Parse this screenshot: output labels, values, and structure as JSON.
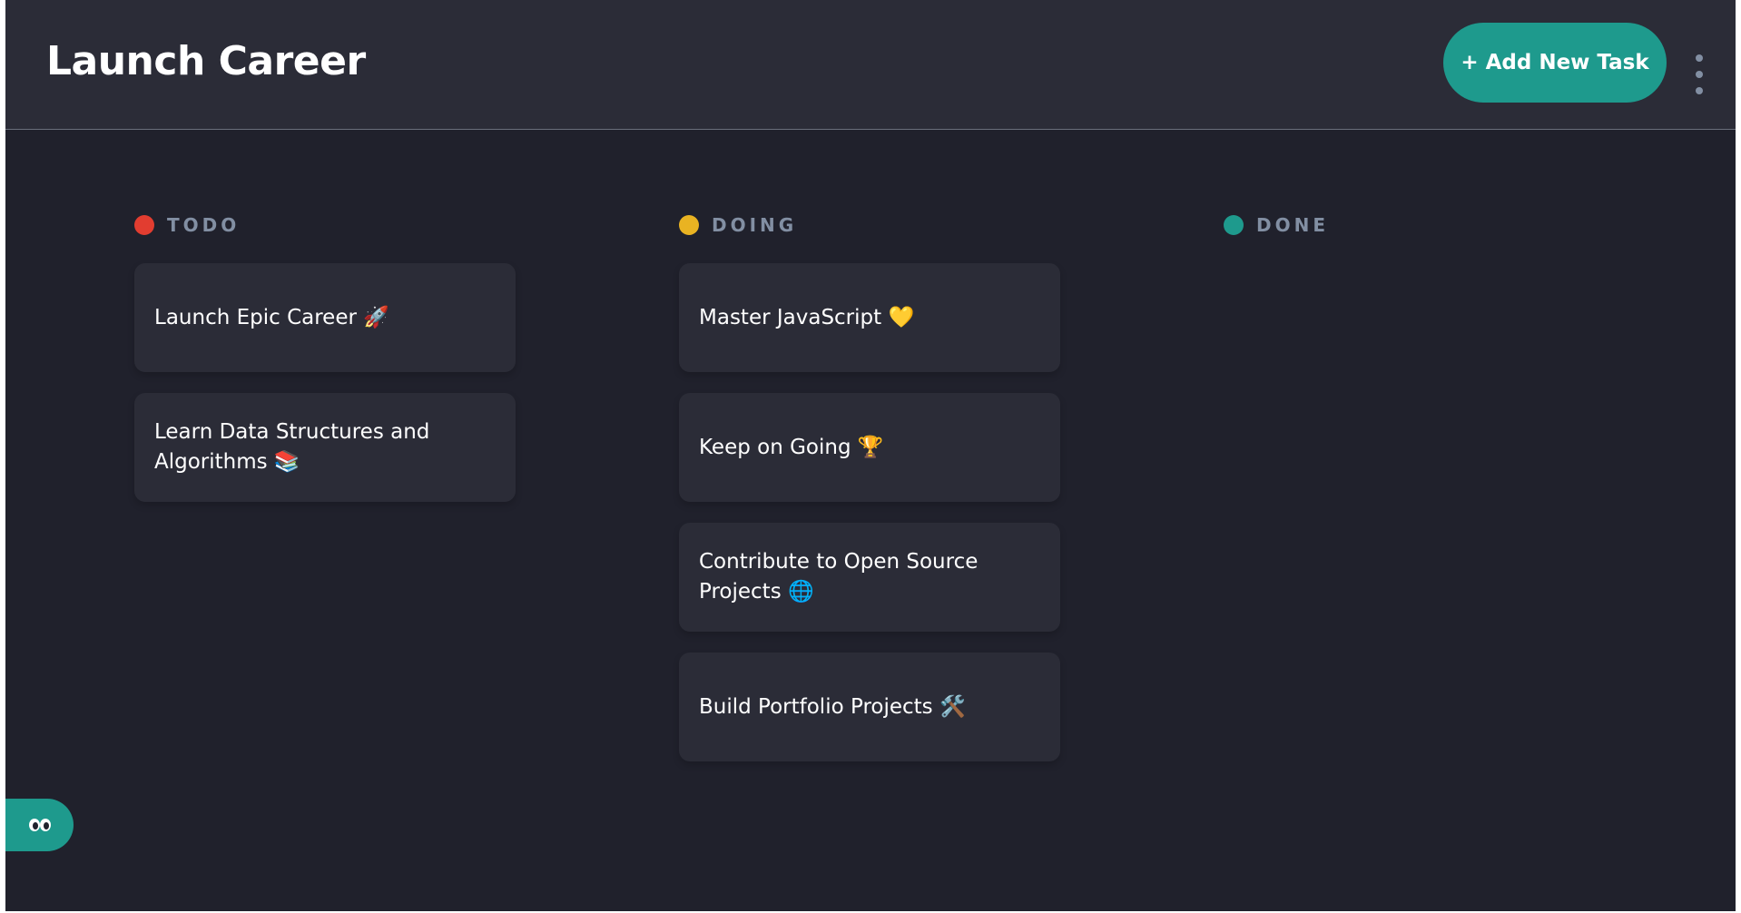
{
  "header": {
    "board_title": "Launch Career",
    "add_task_label": "+ Add New Task",
    "menu_icon": "vertical-ellipsis-icon"
  },
  "colors": {
    "accent": "#1e9a8d",
    "todo": "#e23d30",
    "doing": "#e9b322",
    "done": "#1e9a8d"
  },
  "columns": [
    {
      "title": "TODO",
      "color": "#e23d30",
      "cards": [
        {
          "title": "Launch Epic Career 🚀"
        },
        {
          "title": "Learn Data Structures and Algorithms 📚"
        }
      ]
    },
    {
      "title": "DOING",
      "color": "#e9b322",
      "cards": [
        {
          "title": "Master JavaScript 💛"
        },
        {
          "title": "Keep on Going 🏆"
        },
        {
          "title": "Contribute to Open Source Projects 🌐"
        },
        {
          "title": "Build Portfolio Projects 🛠️"
        }
      ]
    },
    {
      "title": "DONE",
      "color": "#1e9a8d",
      "cards": []
    }
  ],
  "floating_button": {
    "icon": "eyes-icon"
  }
}
